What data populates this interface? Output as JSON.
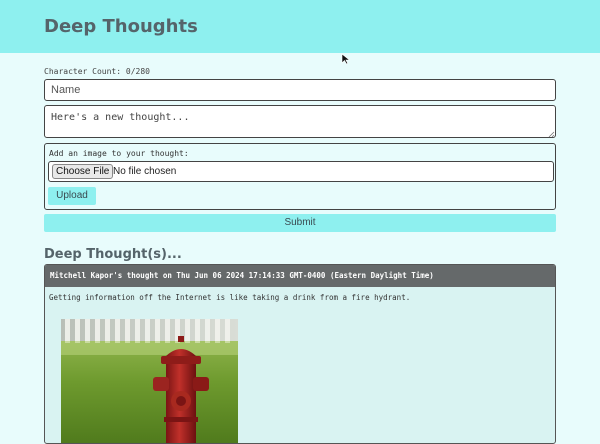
{
  "header": {
    "title": "Deep Thoughts"
  },
  "form": {
    "character_count": "Character Count: 0/280",
    "name_placeholder": "Name",
    "thought_placeholder": "Here's a new thought...",
    "image_label": "Add an image to your thought:",
    "choose_file_label": "Choose File",
    "no_file_text": "No file chosen",
    "upload_label": "Upload",
    "submit_label": "Submit"
  },
  "thoughts": {
    "section_title": "Deep Thought(s)...",
    "items": [
      {
        "header": "Mitchell Kapor's thought on Thu Jun 06 2024 17:14:33 GMT-0400 (Eastern Daylight Time)",
        "text": "Getting information off the Internet is like taking a drink from a fire hydrant."
      }
    ]
  },
  "colors": {
    "accent": "#8ef0ef",
    "background": "#e8fcfc",
    "card_header": "#65696a"
  }
}
